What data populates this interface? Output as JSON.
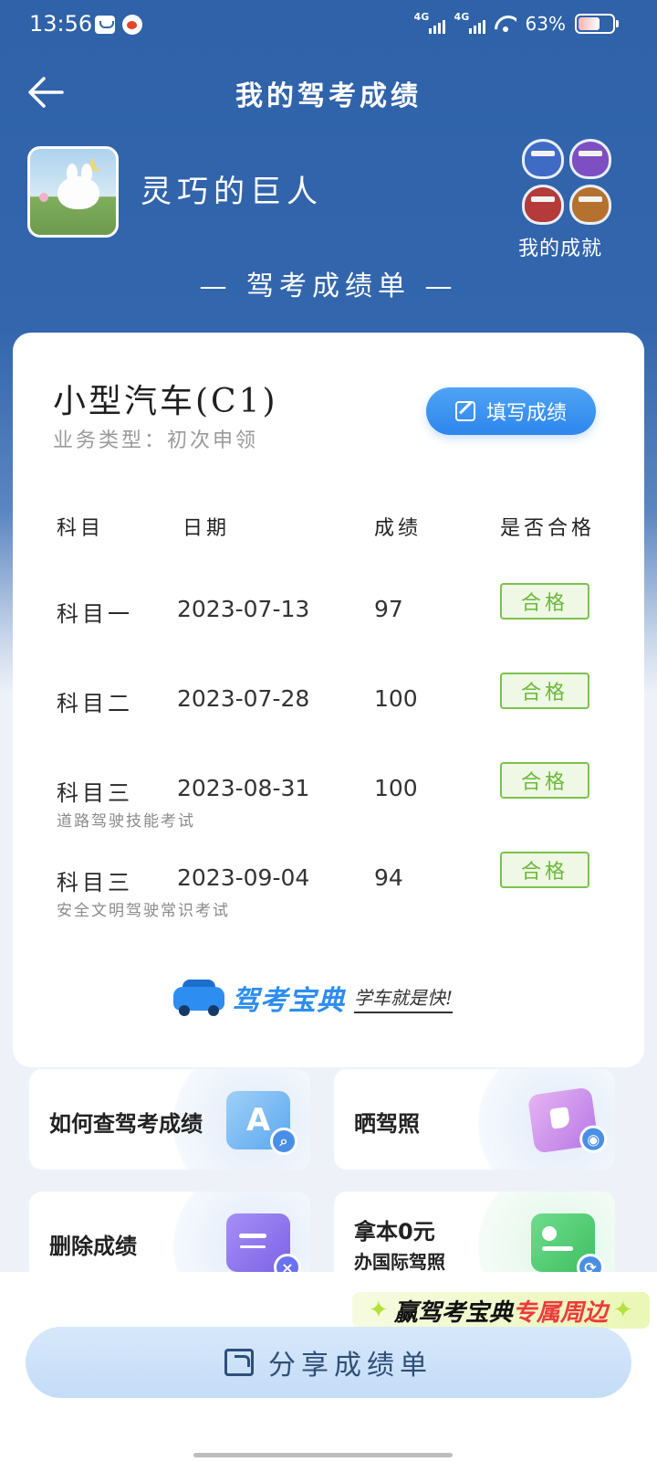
{
  "status": {
    "time": "13:56",
    "net1": "4G",
    "net2": "4G",
    "battery": "63%",
    "battery_level": 0.63
  },
  "header": {
    "title": "我的驾考成绩"
  },
  "profile": {
    "username": "灵巧的巨人",
    "achievements_label": "我的成就"
  },
  "report": {
    "title": "— 驾考成绩单 —"
  },
  "license": {
    "type": "小型汽车(C1)",
    "business_type": "业务类型：初次申领",
    "fill_button": "填写成绩"
  },
  "table": {
    "headers": [
      "科目",
      "日期",
      "成绩",
      "是否合格"
    ],
    "rows": [
      {
        "subject": "科目一",
        "sub": "",
        "date": "2023-07-13",
        "score": "97",
        "status": "合格"
      },
      {
        "subject": "科目二",
        "sub": "",
        "date": "2023-07-28",
        "score": "100",
        "status": "合格"
      },
      {
        "subject": "科目三",
        "sub": "道路驾驶技能考试",
        "date": "2023-08-31",
        "score": "100",
        "status": "合格"
      },
      {
        "subject": "科目三",
        "sub": "安全文明驾驶常识考试",
        "date": "2023-09-04",
        "score": "94",
        "status": "合格"
      }
    ]
  },
  "brand": {
    "name": "驾考宝典",
    "slogan": "学车就是快!"
  },
  "tiles": {
    "how_to_check": "如何查驾考成绩",
    "show_license": "晒驾照",
    "delete_scores": "删除成绩",
    "intl_line1": "拿本0元",
    "intl_line2": "办国际驾照"
  },
  "promo": {
    "prefix": "赢驾考宝典",
    "highlight": "专属周边"
  },
  "share": {
    "label": "分享成绩单"
  }
}
